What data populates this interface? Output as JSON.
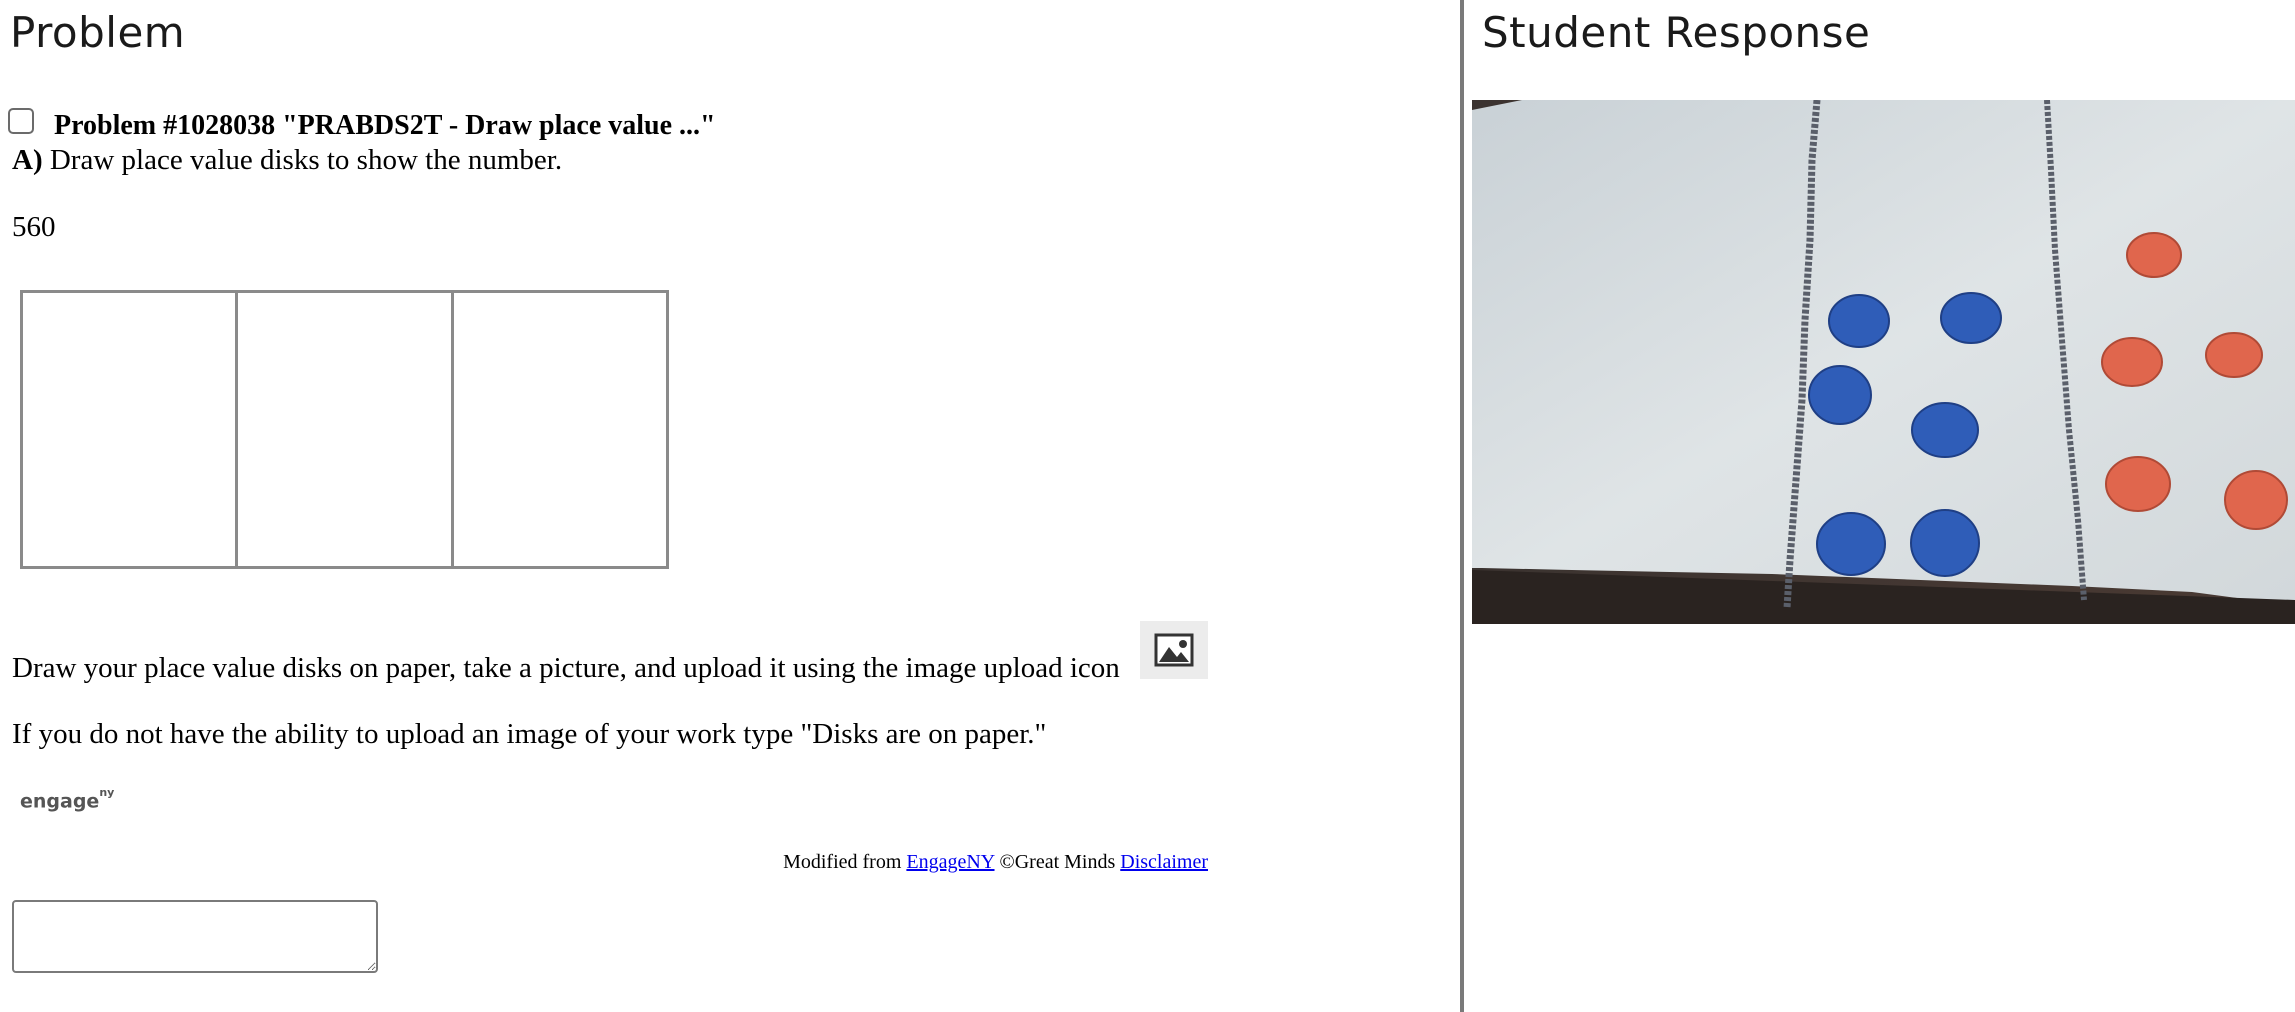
{
  "problem_pane": {
    "title": "Problem",
    "problem_header": "Problem #1028038 \"PRABDS2T - Draw place value ...\"",
    "part_label": "A)",
    "question": " Draw place value disks to show the number.",
    "number": "560",
    "instructions": "Draw your place value disks on paper, take a picture, and upload it using the image upload icon",
    "upload_icon": "image-icon",
    "note": "If you do not have the ability to upload an image of your work type \"Disks are on paper.\"",
    "logo": {
      "text": "engage",
      "superscript": "ny"
    },
    "credit": {
      "prefix": "Modified from ",
      "link1": "EngageNY",
      "middle": " ©Great Minds ",
      "link2": "Disclaimer"
    },
    "answer_value": ""
  },
  "response_pane": {
    "title": "Student Response"
  },
  "colors": {
    "divider": "#7a7a7a",
    "link": "#0000ee",
    "blue_disk": "#2f5db8",
    "red_disk": "#e0664d"
  }
}
